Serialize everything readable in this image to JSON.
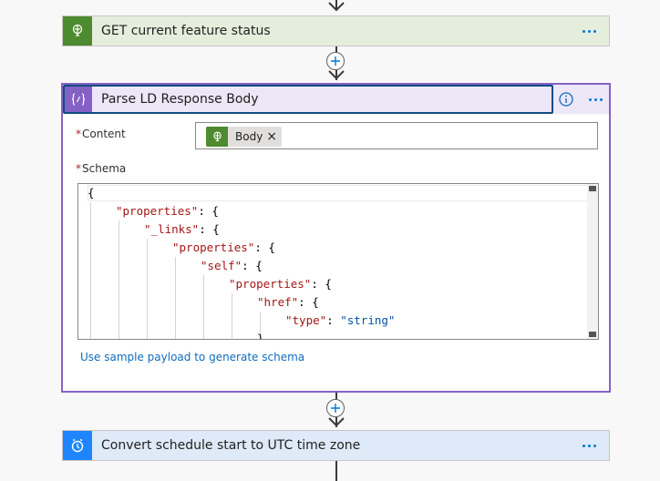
{
  "steps": [
    {
      "title": "GET current feature status",
      "accent": "#4e8a2f",
      "bg": "#e5eedd",
      "icon": "globe-icon"
    },
    {
      "title": "Parse LD Response Body",
      "accent": "#8661c5",
      "bg": "#ede7f8",
      "icon": "curly-braces-icon"
    },
    {
      "title": "Convert schedule start to UTC time zone",
      "accent": "#1f85ff",
      "bg": "#dfeaf8",
      "icon": "clock-icon"
    }
  ],
  "parse": {
    "content_label": "Content",
    "schema_label": "Schema",
    "token_label": "Body",
    "sample_link": "Use sample payload to generate schema"
  },
  "schema_lines": [
    {
      "indent": 0,
      "key": "",
      "rest": "{"
    },
    {
      "indent": 1,
      "key": "\"properties\"",
      "rest": ": {"
    },
    {
      "indent": 2,
      "key": "\"_links\"",
      "rest": ": {"
    },
    {
      "indent": 3,
      "key": "\"properties\"",
      "rest": ": {"
    },
    {
      "indent": 4,
      "key": "\"self\"",
      "rest": ": {"
    },
    {
      "indent": 5,
      "key": "\"properties\"",
      "rest": ": {"
    },
    {
      "indent": 6,
      "key": "\"href\"",
      "rest": ": {"
    },
    {
      "indent": 7,
      "key": "\"type\"",
      "rest": ": ",
      "value": "\"string\""
    },
    {
      "indent": 6,
      "key": "",
      "rest": "}"
    }
  ]
}
